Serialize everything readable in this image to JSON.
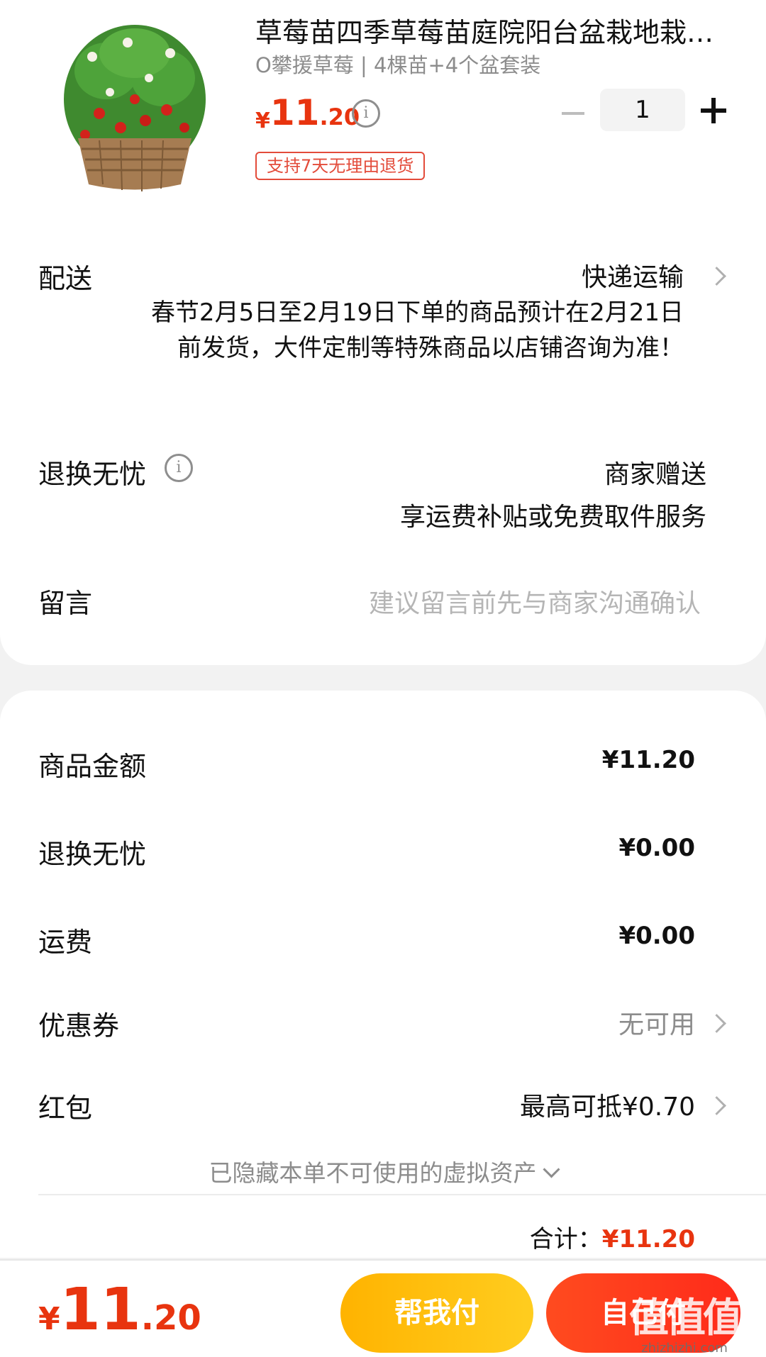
{
  "product": {
    "title": "草莓苗四季草莓苗庭院阳台盆栽地栽…",
    "sku": "O攀援草莓 | 4棵苗+4个盆套装",
    "price_currency": "¥",
    "price_int": "11",
    "price_dec": ".20",
    "quantity": "1",
    "return_badge": "支持7天无理由退货"
  },
  "delivery": {
    "label": "配送",
    "value": "快递运输",
    "note": "春节2月5日至2月19日下单的商品预计在2月21日前发货，大件定制等特殊商品以店铺咨询为准！"
  },
  "return_service": {
    "label": "退换无忧",
    "value": "商家赠送",
    "sub": "享运费补贴或免费取件服务"
  },
  "message": {
    "label": "留言",
    "placeholder": "建议留言前先与商家沟通确认"
  },
  "summary": {
    "rows": [
      {
        "label": "商品金额",
        "value": "¥11.20"
      },
      {
        "label": "退换无忧",
        "value": "¥0.00"
      },
      {
        "label": "运费",
        "value": "¥0.00"
      }
    ],
    "coupon": {
      "label": "优惠券",
      "value": "无可用"
    },
    "red_packet": {
      "label": "红包",
      "value": "最高可抵¥0.70"
    },
    "hidden_assets": "已隐藏本单不可使用的虚拟资产",
    "total_label": "合计：",
    "total_value": "¥11.20"
  },
  "action_bar": {
    "price_currency": "¥",
    "price_int": "11",
    "price_dec": ".20",
    "help_pay": "帮我付",
    "self_pay": "自己付"
  },
  "watermark": {
    "glyphs": "值值值",
    "url": "zhizhizhi.com"
  },
  "colors": {
    "accent_red": "#e8340f",
    "help_button": "#ffbf10",
    "self_button": "#ff3a1c"
  }
}
